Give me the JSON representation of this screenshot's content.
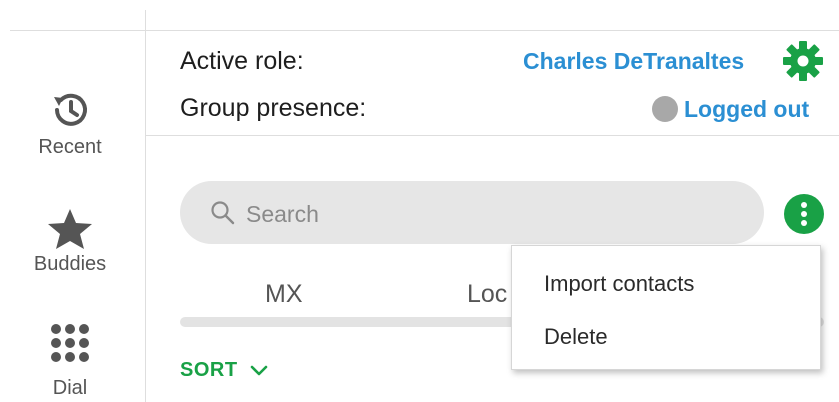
{
  "nav": {
    "items": [
      {
        "label": "Recent",
        "icon": "history-icon"
      },
      {
        "label": "Buddies",
        "icon": "star-icon"
      },
      {
        "label": "Dial",
        "icon": "dialpad-icon"
      }
    ]
  },
  "header": {
    "active_role_label": "Active role:",
    "active_role_value": "Charles DeTranaltes",
    "group_presence_label": "Group presence:",
    "group_presence_value": "Logged out"
  },
  "search": {
    "placeholder": "Search"
  },
  "tabs": [
    {
      "label": "MX"
    },
    {
      "label": "Loc"
    }
  ],
  "sort": {
    "label": "SORT"
  },
  "menu": {
    "items": [
      {
        "label": "Import contacts"
      },
      {
        "label": "Delete"
      }
    ]
  },
  "colors": {
    "accent_green": "#19a146",
    "link_blue": "#2b8fd3",
    "status_gray": "#a8a8a8"
  }
}
